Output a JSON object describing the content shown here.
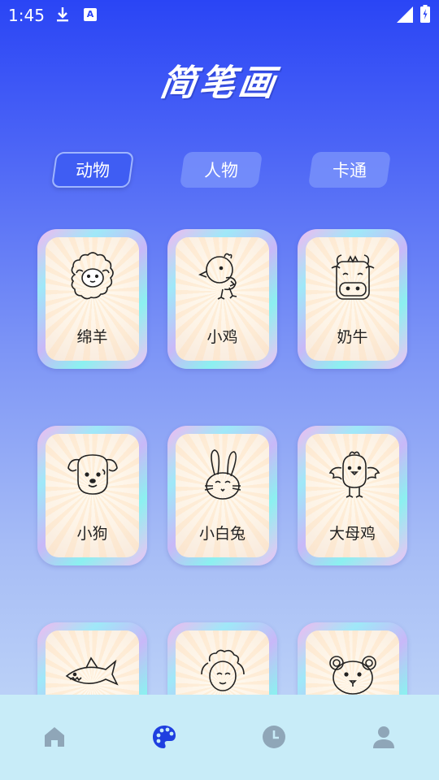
{
  "status_bar": {
    "time": "1:45",
    "notification_icons": [
      "download-icon",
      "a-icon"
    ],
    "system_icons": [
      "signal-icon",
      "battery-icon"
    ]
  },
  "app": {
    "title": "简笔画"
  },
  "tabs": [
    {
      "label": "动物",
      "active": true
    },
    {
      "label": "人物",
      "active": false
    },
    {
      "label": "卡通",
      "active": false
    }
  ],
  "grid": {
    "items": [
      {
        "label": "绵羊",
        "icon": "sheep-drawing"
      },
      {
        "label": "小鸡",
        "icon": "chick-drawing"
      },
      {
        "label": "奶牛",
        "icon": "cow-drawing"
      },
      {
        "label": "小狗",
        "icon": "dog-drawing"
      },
      {
        "label": "小白兔",
        "icon": "rabbit-drawing"
      },
      {
        "label": "大母鸡",
        "icon": "hen-drawing"
      },
      {
        "label": "",
        "icon": "shark-drawing"
      },
      {
        "label": "",
        "icon": "lamb-drawing"
      },
      {
        "label": "",
        "icon": "bear-drawing"
      }
    ]
  },
  "bottom_nav": [
    {
      "name": "home",
      "icon": "home-icon",
      "active": false
    },
    {
      "name": "palette",
      "icon": "palette-icon",
      "active": true
    },
    {
      "name": "history",
      "icon": "clock-icon",
      "active": false
    },
    {
      "name": "profile",
      "icon": "user-icon",
      "active": false
    }
  ],
  "colors": {
    "accent": "#2a45f5",
    "nav_active": "#1f3fe0",
    "nav_inactive": "#8fa6b8",
    "nav_bg": "#c8ecf8"
  }
}
